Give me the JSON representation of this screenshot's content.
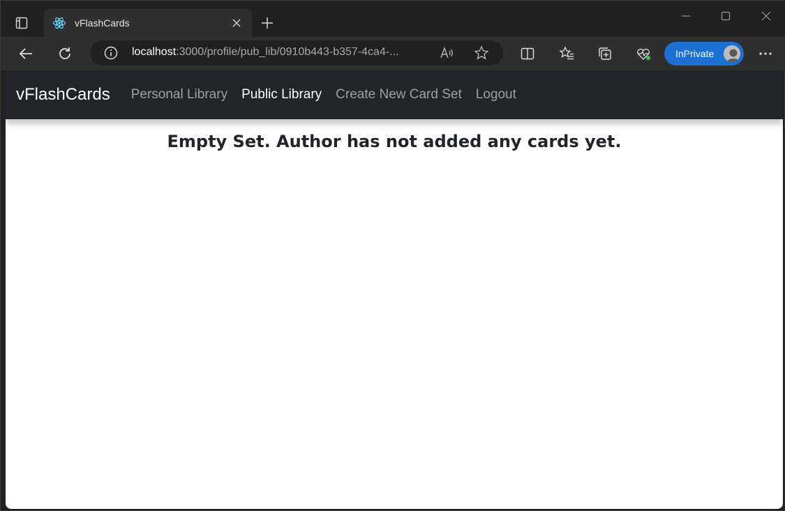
{
  "browser": {
    "tab": {
      "title": "vFlashCards"
    },
    "address": {
      "host": "localhost",
      "path": ":3000/profile/pub_lib/0910b443-b357-4ca4-..."
    },
    "profile": {
      "label": "InPrivate"
    }
  },
  "app": {
    "brand": "vFlashCards",
    "nav": [
      {
        "label": "Personal Library",
        "active": false
      },
      {
        "label": "Public Library",
        "active": true
      },
      {
        "label": "Create New Card Set",
        "active": false
      },
      {
        "label": "Logout",
        "active": false
      }
    ],
    "message": "Empty Set. Author has not added any cards yet."
  },
  "icons": {
    "favicon": "react-atom-icon",
    "colors": {
      "navbar": "#212529",
      "inprivate": "#1d6fd1",
      "react": "#61dafb"
    }
  }
}
